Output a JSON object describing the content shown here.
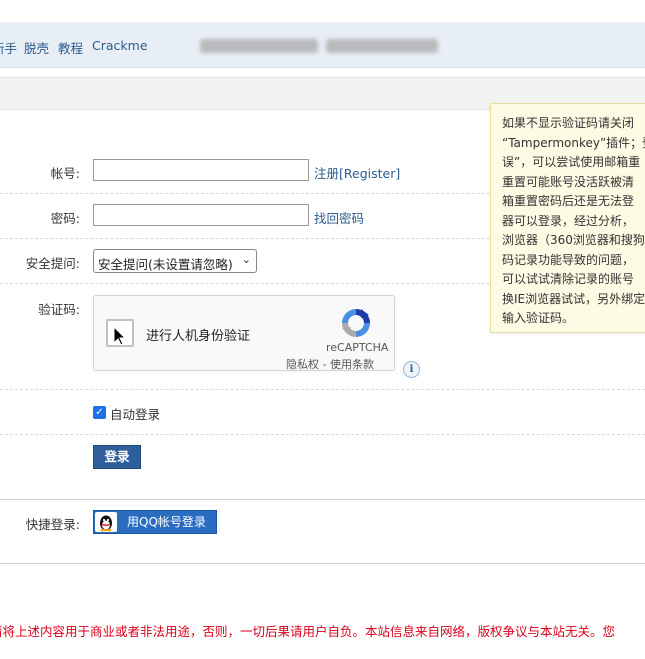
{
  "nav": {
    "items": [
      "新手",
      "脱壳",
      "教程",
      "Crackme"
    ]
  },
  "form": {
    "account_label": "帐号:",
    "register_link": "注册[Register]",
    "password_label": "密码:",
    "forgot_link": "找回密码",
    "question_label": "安全提问:",
    "question_value": "安全提问(未设置请忽略)",
    "captcha_label": "验证码:",
    "autologin_label": "自动登录",
    "login_button": "登录",
    "quick_login_label": "快捷登录:",
    "qq_button": "用QQ帐号登录"
  },
  "recaptcha": {
    "label": "进行人机身份验证",
    "brand": "reCAPTCHA",
    "terms": "隐私权 - 使用条款"
  },
  "tooltip": {
    "lines": [
      "如果不显示验证码请关闭",
      "“Tampermonkey”插件；登",
      "误”，可以尝试使用邮箱重",
      "重置可能账号没活跃被清",
      "箱重置密码后还是无法登",
      "器可以登录，经过分析，",
      "浏览器（360浏览器和搜狗",
      "码记录功能导致的问题，",
      "可以试试清除记录的账号",
      "换IE浏览器试试，另外绑定",
      "输入验证码。"
    ]
  },
  "footer": {
    "notice": "请将上述内容用于商业或者非法用途，否则，一切后果请用户自负。本站信息来自网络，版权争议与本站无关。您"
  }
}
